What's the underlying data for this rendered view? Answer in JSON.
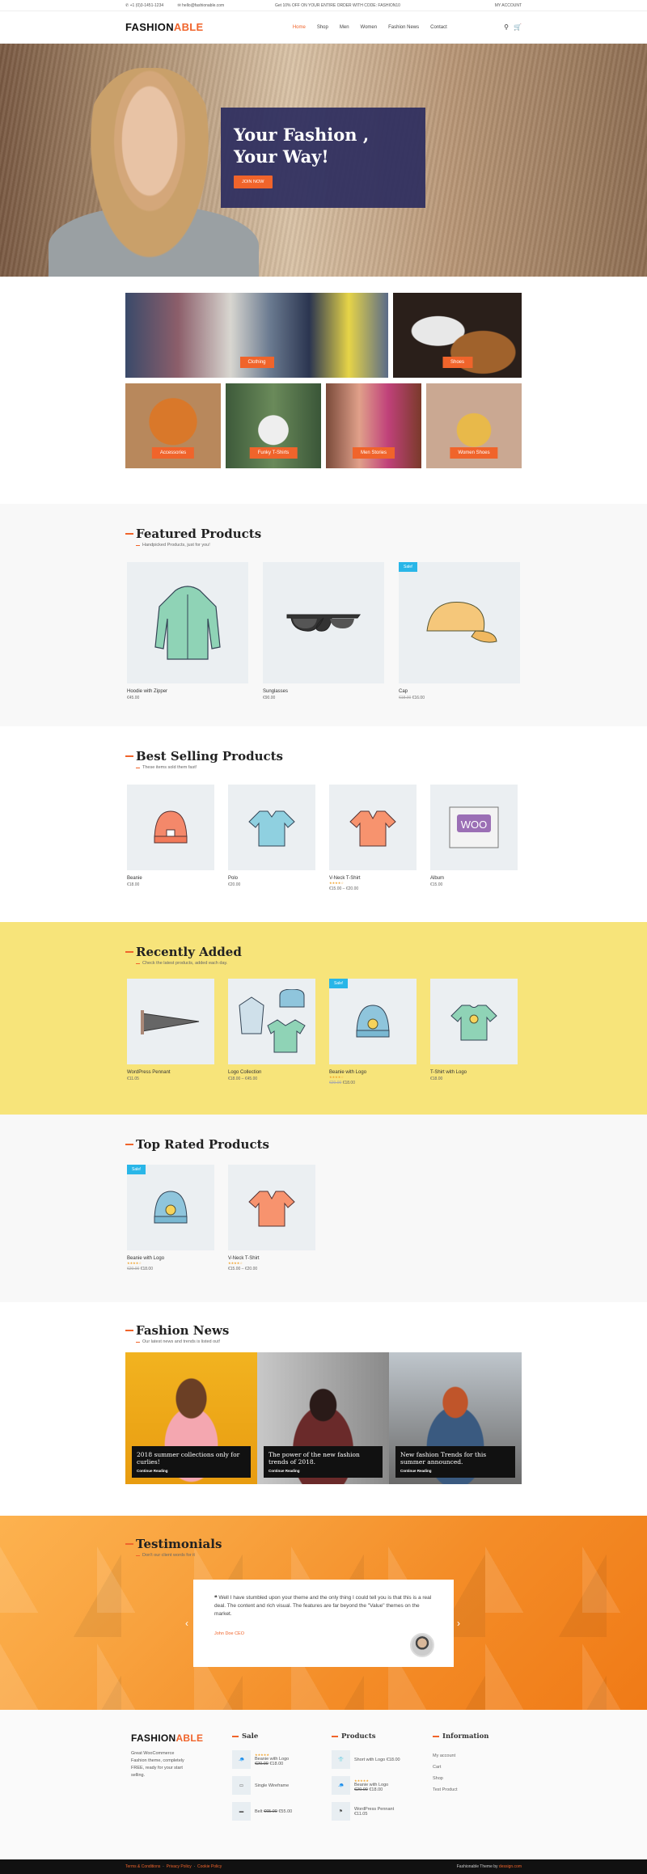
{
  "topbar": {
    "phone": "+1 (0)3-1451-1234",
    "email": "hello@fashionable.com",
    "promo": "Get 10% OFF ON YOUR ENTIRE ORDER WITH CODE: FASHION10",
    "account": "MY ACCOUNT"
  },
  "header": {
    "logo_main": "FASHION",
    "logo_accent": "ABLE",
    "nav": [
      "Home",
      "Shop",
      "Men",
      "Women",
      "Fashion News",
      "Contact"
    ]
  },
  "hero": {
    "title_line1": "Your Fashion ,",
    "title_line2": "Your Way!",
    "button": "JOIN NOW"
  },
  "categories": [
    "Clothing",
    "Shoes",
    "Accessories",
    "Funky T-Shirts",
    "Men Stories",
    "Women Shoes"
  ],
  "featured": {
    "title": "Featured Products",
    "subtitle": "Handpicked Products, just for you!",
    "products": [
      {
        "name": "Hoodie with Zipper",
        "price": "€45.00"
      },
      {
        "name": "Sunglasses",
        "price": "€90.00"
      },
      {
        "name": "Cap",
        "old_price": "€18.00",
        "price": "€16.00",
        "badge": "Sale!"
      }
    ]
  },
  "best": {
    "title": "Best Selling Products",
    "subtitle": "These items sold them fast!",
    "products": [
      {
        "name": "Beanie",
        "price": "€18.00"
      },
      {
        "name": "Polo",
        "price": "€20.00"
      },
      {
        "name": "V-Neck T-Shirt",
        "price": "€15.00 – €20.00"
      },
      {
        "name": "Album",
        "price": "€15.00"
      }
    ]
  },
  "recent": {
    "title": "Recently Added",
    "subtitle": "Check the latest products, added each day.",
    "products": [
      {
        "name": "WordPress Pennant",
        "price": "€11.05"
      },
      {
        "name": "Logo Collection",
        "price": "€18.00 – €45.00"
      },
      {
        "name": "Beanie with Logo",
        "old_price": "€20.00",
        "price": "€18.00",
        "badge": "Sale!"
      },
      {
        "name": "T-Shirt with Logo",
        "price": "€18.00"
      }
    ]
  },
  "toprated": {
    "title": "Top Rated Products",
    "products": [
      {
        "name": "Beanie with Logo",
        "old_price": "€20.00",
        "price": "€18.00",
        "badge": "Sale!"
      },
      {
        "name": "V-Neck T-Shirt",
        "price": "€15.00 – €20.00"
      }
    ]
  },
  "news": {
    "title": "Fashion News",
    "subtitle": "Our latest news and trends is listed out!",
    "read_more": "Continue Reading",
    "items": [
      {
        "title": "2018 summer collections only for curlies!"
      },
      {
        "title": "The power of the new fashion trends of 2018."
      },
      {
        "title": "New fashion Trends for this summer announced."
      }
    ]
  },
  "testimonials": {
    "title": "Testimonials",
    "subtitle": "Don't our client words for it",
    "quote": "Well I have stumbled upon your theme and the only thing I could tell you is that this is a real deal. The content and rich visual. The features are far beyond the \"Value\" themes on the market.",
    "author": "John Doe CEO"
  },
  "footer": {
    "logo_main": "FASHION",
    "logo_accent": "ABLE",
    "about": "Great WooCommerce Fashion theme, completely FREE, ready for your start selling.",
    "sale_title": "Sale",
    "products_title": "Products",
    "info_title": "Information",
    "sale_items": [
      {
        "name": "Beanie with Logo",
        "old_price": "€20.00",
        "price": "€18.00"
      },
      {
        "name": "Single Wireframe",
        "price": ""
      },
      {
        "name": "Belt",
        "old_price": "€65.00",
        "price": "€55.00"
      }
    ],
    "product_items": [
      {
        "name": "Short with Logo",
        "price": "€18.00"
      },
      {
        "name": "Beanie with Logo",
        "old_price": "€20.00",
        "price": "€18.00"
      },
      {
        "name": "WordPress Pennant",
        "price": "€11.05"
      }
    ],
    "info_links": [
      "My account",
      "Cart",
      "Shop",
      "Test Product"
    ]
  },
  "bottombar": {
    "links": [
      "Terms & Conditions",
      "Privacy Policy",
      "Cookie Policy"
    ],
    "credit": "Fashionable Theme by",
    "credit_by": "dessign.com"
  },
  "colors": {
    "accent": "#f0642b",
    "navy": "#2d2d5f",
    "yellow": "#f7e47a",
    "sale": "#29b6e8"
  }
}
